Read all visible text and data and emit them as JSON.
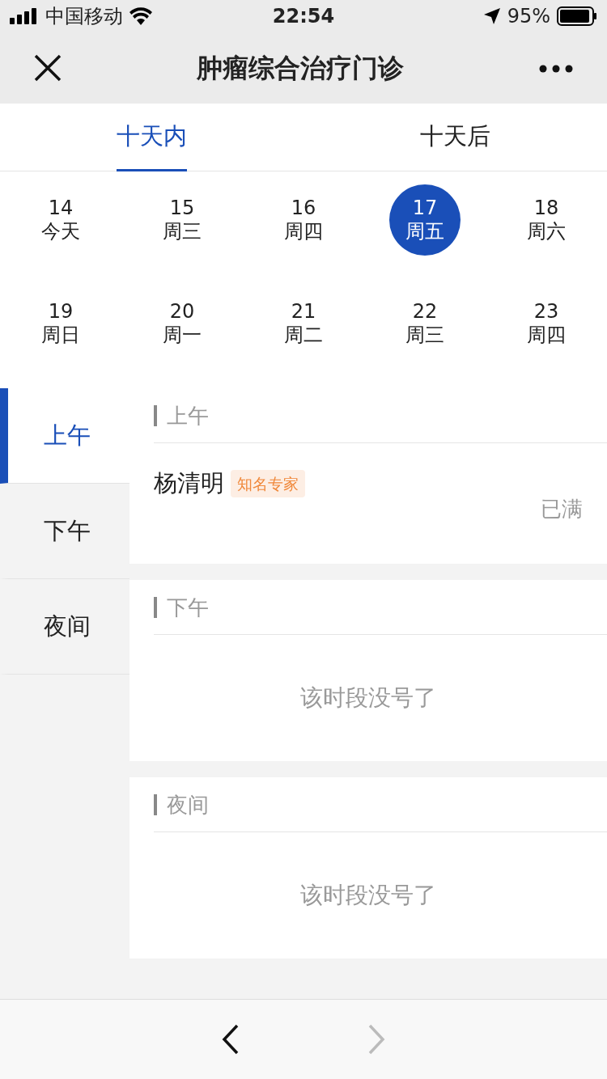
{
  "status_bar": {
    "carrier": "中国移动",
    "time": "22:54",
    "battery": "95%"
  },
  "nav": {
    "title": "肿瘤综合治疗门诊"
  },
  "tabs": [
    {
      "label": "十天内",
      "selected": true
    },
    {
      "label": "十天后",
      "selected": false
    }
  ],
  "dates": [
    {
      "day": "14",
      "weekday": "今天",
      "selected": false
    },
    {
      "day": "15",
      "weekday": "周三",
      "selected": false
    },
    {
      "day": "16",
      "weekday": "周四",
      "selected": false
    },
    {
      "day": "17",
      "weekday": "周五",
      "selected": true
    },
    {
      "day": "18",
      "weekday": "周六",
      "selected": false
    },
    {
      "day": "19",
      "weekday": "周日",
      "selected": false
    },
    {
      "day": "20",
      "weekday": "周一",
      "selected": false
    },
    {
      "day": "21",
      "weekday": "周二",
      "selected": false
    },
    {
      "day": "22",
      "weekday": "周三",
      "selected": false
    },
    {
      "day": "23",
      "weekday": "周四",
      "selected": false
    }
  ],
  "periods": [
    {
      "label": "上午",
      "selected": true
    },
    {
      "label": "下午",
      "selected": false
    },
    {
      "label": "夜间",
      "selected": false
    }
  ],
  "sections": [
    {
      "title": "上午",
      "doctors": [
        {
          "name": "杨清明",
          "tag": "知名专家",
          "status": "已满"
        }
      ]
    },
    {
      "title": "下午",
      "empty_text": "该时段没号了"
    },
    {
      "title": "夜间",
      "empty_text": "该时段没号了"
    }
  ],
  "toolbar": {
    "back": {
      "disabled": false
    },
    "forward": {
      "disabled": true
    }
  }
}
